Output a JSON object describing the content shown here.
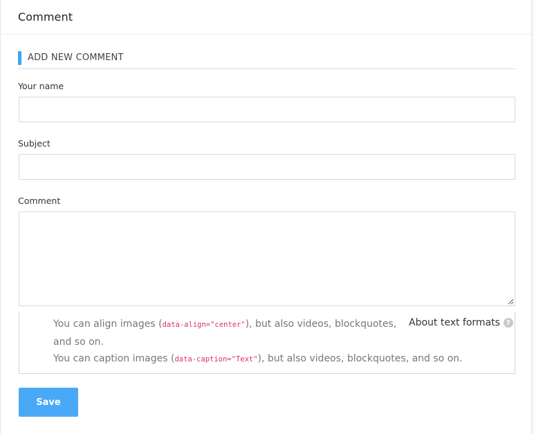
{
  "header": {
    "title": "Comment"
  },
  "form": {
    "section_title": "ADD NEW COMMENT",
    "name_label": "Your name",
    "name_value": "",
    "subject_label": "Subject",
    "subject_value": "",
    "comment_label": "Comment",
    "comment_value": ""
  },
  "formats": {
    "tip1_prefix": "You can align images (",
    "tip1_code": "data-align=\"center\"",
    "tip1_suffix": "), but also videos, blockquotes, and so on.",
    "tip2_prefix": "You can caption images (",
    "tip2_code": "data-caption=\"Text\"",
    "tip2_suffix": "), but also videos, blockquotes, and so on.",
    "about_link": "About text formats",
    "help_icon": "question-circle-icon",
    "help_glyph": "?"
  },
  "actions": {
    "save_label": "Save"
  },
  "colors": {
    "accent": "#3aa6f4",
    "button": "#4aa9f7",
    "code": "#d6336c"
  }
}
